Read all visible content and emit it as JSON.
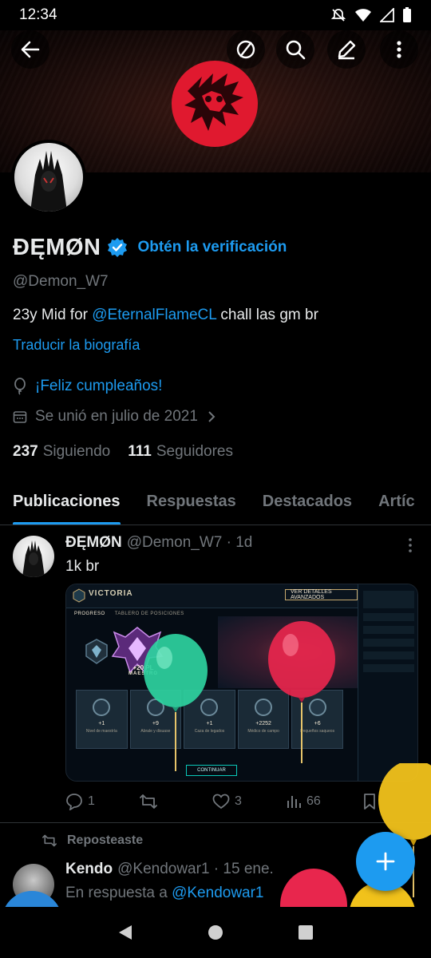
{
  "status_bar": {
    "time": "12:34"
  },
  "profile": {
    "display_name": "ĐĘMØN",
    "verify_cta": "Obtén la verificación",
    "handle": "@Demon_W7",
    "bio_prefix": "23y  Mid for ",
    "bio_mention": "@EternalFlameCL",
    "bio_suffix": "  chall las gm br",
    "translate_label": "Traducir la biografía",
    "birthday_label": "¡Feliz cumpleaños!",
    "joined_label": "Se unió en julio de 2021",
    "following_count": "237",
    "following_label": "Siguiendo",
    "followers_count": "111",
    "followers_label": "Seguidores"
  },
  "tabs": [
    {
      "label": "Publicaciones",
      "active": true
    },
    {
      "label": "Respuestas",
      "active": false
    },
    {
      "label": "Destacados",
      "active": false
    },
    {
      "label": "Artíc",
      "active": false
    }
  ],
  "tweet": {
    "name": "ĐĘMØN",
    "handle_time": "@Demon_W7 · 1d",
    "text": "1k br",
    "media": {
      "player_name": "VICTORIA",
      "details_button": "VER DETALLES AVANZADOS",
      "tab1": "PROGRESO",
      "tab2": "TABLERO DE POSICIONES",
      "rank_label": "MAESTRO",
      "lp_label": "+20 PL",
      "continue_button": "CONTINUAR",
      "cards": [
        {
          "value": "+1",
          "caption": "Nivel de maestría"
        },
        {
          "value": "+9",
          "caption": "Abrale y disuase"
        },
        {
          "value": "+1",
          "caption": "Caza de legados"
        },
        {
          "value": "+2252",
          "caption": "Médico de campo"
        },
        {
          "value": "+6",
          "caption": "Pequeños saqueos"
        }
      ]
    },
    "stats": {
      "replies": "1",
      "reposts": "",
      "likes": "3",
      "views": "66"
    }
  },
  "repost": {
    "label": "Reposteaste",
    "name": "Kendo",
    "handle_time": "@Kendowar1 · 15 ene.",
    "reply_prefix": "En respuesta a ",
    "reply_mention": "@Kendowar1"
  },
  "colors": {
    "accent": "#1d9bf0",
    "background": "#000000",
    "muted": "#71767b",
    "text": "#e7e9ea"
  }
}
